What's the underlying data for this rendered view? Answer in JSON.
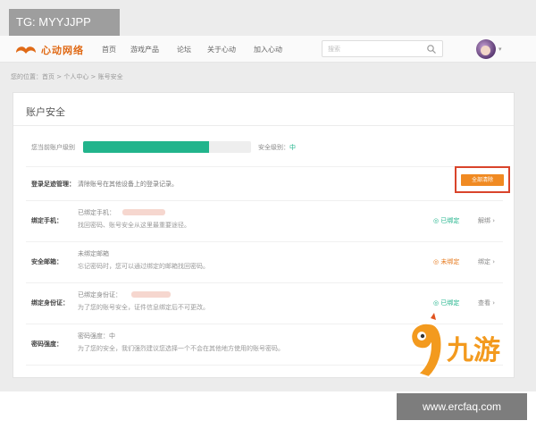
{
  "watermark": {
    "tg": "TG: MYYJJPP",
    "url": "www.ercfaq.com",
    "brand": "九游"
  },
  "header": {
    "logo_text": "心动网络",
    "nav": [
      "首页",
      "游戏产品",
      "论坛",
      "关于心动",
      "加入心动"
    ],
    "search_placeholder": "搜索"
  },
  "breadcrumb": "您的位置：首页 > 个人中心 > 账号安全",
  "panel": {
    "title": "账户安全",
    "level": {
      "label": "您当前账户级别",
      "text": "安全级别：",
      "value": "中",
      "progress": 0.75
    },
    "login": {
      "label": "登录足迹管理：",
      "desc": "清除账号在其他设备上的登录记录。",
      "button": "全部清除"
    },
    "rows": [
      {
        "label": "绑定手机：",
        "line1": "已绑定手机：",
        "line2": "找回密码、账号安全从这里最重要途径。",
        "status": "◎ 已绑定",
        "status_kind": "ok",
        "action": "解绑 ›"
      },
      {
        "label": "安全邮箱：",
        "line1": "未绑定邮箱",
        "line2": "忘记密码时，您可以通过绑定的邮箱找回密码。",
        "status": "◎ 未绑定",
        "status_kind": "warn",
        "action": "绑定 ›"
      },
      {
        "label": "绑定身份证：",
        "line1": "已绑定身份证：",
        "line2": "为了您的账号安全，证件信息绑定后不可更改。",
        "status": "◎ 已绑定",
        "status_kind": "ok",
        "action": "查看 ›"
      },
      {
        "label": "密码强度：",
        "line1": "密码强度：中",
        "line2": "为了您的安全，我们强烈建议您选择一个不会在其他地方使用的账号密码。",
        "status": "",
        "status_kind": "",
        "action": ""
      }
    ]
  },
  "colors": {
    "accent": "#22b48c",
    "orange": "#f08a22",
    "highlight": "#d9442b",
    "logo": "#e06a16"
  }
}
